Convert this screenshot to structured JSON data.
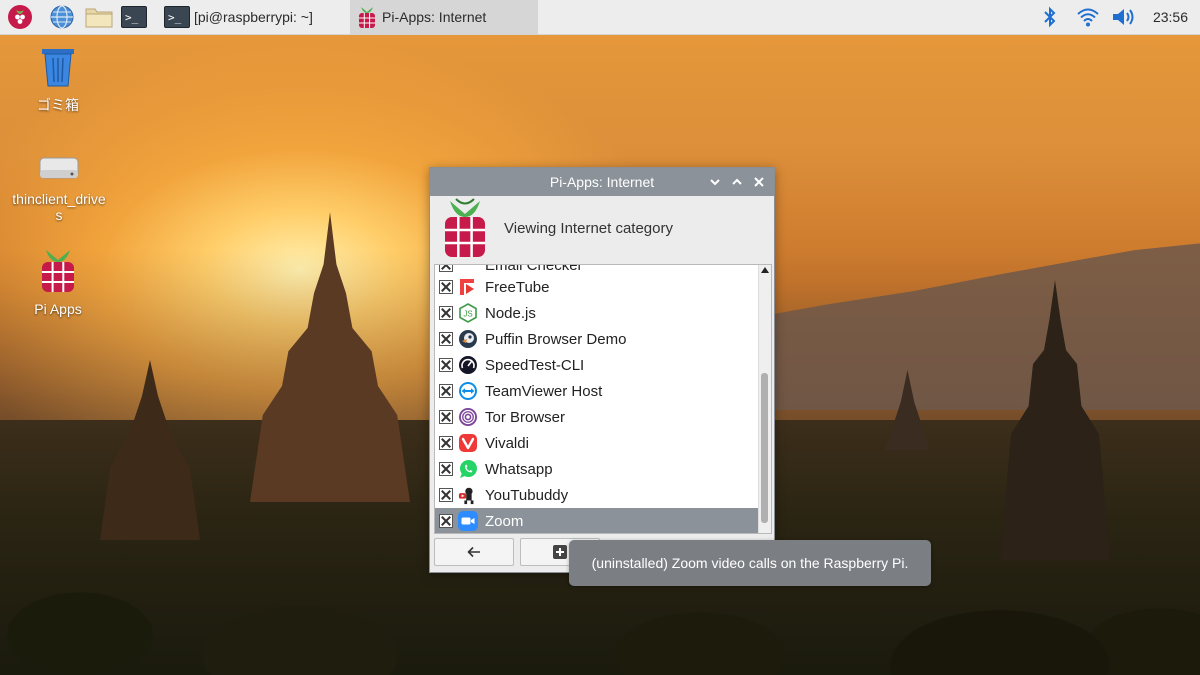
{
  "taskbar": {
    "tasks": [
      {
        "label": "[pi@raspberrypi: ~]"
      },
      {
        "label": "Pi-Apps: Internet"
      }
    ],
    "clock": "23:56"
  },
  "desktop": {
    "icons": [
      {
        "label": "ゴミ箱",
        "icon": "trash-icon"
      },
      {
        "label": "thinclient_drives",
        "icon": "drive-icon"
      },
      {
        "label": "Pi Apps",
        "icon": "raspberry-icon"
      }
    ]
  },
  "window": {
    "title": "Pi-Apps: Internet",
    "header_text": "Viewing Internet category",
    "partial_top_item": "Email Checker",
    "apps": [
      {
        "name": "FreeTube",
        "icon": "freetube-icon",
        "color": "#e53b32"
      },
      {
        "name": "Node.js",
        "icon": "nodejs-icon",
        "color": "#3f9a45"
      },
      {
        "name": "Puffin Browser Demo",
        "icon": "puffin-icon",
        "color": "#2a3a4d"
      },
      {
        "name": "SpeedTest-CLI",
        "icon": "speedtest-icon",
        "color": "#141526"
      },
      {
        "name": "TeamViewer Host",
        "icon": "teamviewer-icon",
        "color": "#0e8ee9"
      },
      {
        "name": "Tor Browser",
        "icon": "tor-icon",
        "color": "#7d4698"
      },
      {
        "name": "Vivaldi",
        "icon": "vivaldi-icon",
        "color": "#ef3939"
      },
      {
        "name": "Whatsapp",
        "icon": "whatsapp-icon",
        "color": "#25d366"
      },
      {
        "name": "YouTubuddy",
        "icon": "youtubuddy-icon",
        "color": "#d12d2d"
      },
      {
        "name": "Zoom",
        "icon": "zoom-icon",
        "color": "#2d8cff",
        "selected": true
      }
    ]
  },
  "tooltip": {
    "text": "(uninstalled) Zoom video calls on the Raspberry Pi."
  }
}
